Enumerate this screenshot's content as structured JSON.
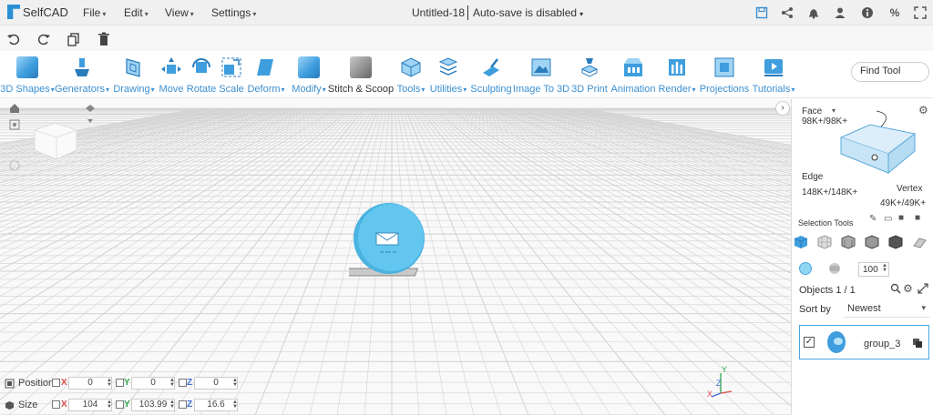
{
  "app": {
    "name": "SelfCAD"
  },
  "menu": [
    {
      "label": "File"
    },
    {
      "label": "Edit"
    },
    {
      "label": "View"
    },
    {
      "label": "Settings"
    }
  ],
  "document": {
    "title": "Untitled-18",
    "autosave": "Auto-save is disabled"
  },
  "toolbar_icons": [
    "save-icon",
    "share-icon",
    "bell-icon",
    "user-icon",
    "info-icon",
    "percent-icon",
    "fullscreen-icon"
  ],
  "quick_icons": [
    "undo-icon",
    "redo-icon",
    "copy-icon",
    "trash-icon"
  ],
  "tools": [
    {
      "label": "3D Shapes",
      "dropdown": true
    },
    {
      "label": "Generators",
      "dropdown": true
    },
    {
      "label": "Drawing",
      "dropdown": true
    },
    {
      "label": "Move",
      "dropdown": false
    },
    {
      "label": "Rotate",
      "dropdown": false
    },
    {
      "label": "Scale",
      "dropdown": false
    },
    {
      "label": "Deform",
      "dropdown": true
    },
    {
      "label": "Modify",
      "dropdown": true
    },
    {
      "label": "Stitch & Scoop",
      "dropdown": false
    },
    {
      "label": "Tools",
      "dropdown": true
    },
    {
      "label": "Utilities",
      "dropdown": true
    },
    {
      "label": "Sculpting",
      "dropdown": false
    },
    {
      "label": "Image To 3D",
      "dropdown": false
    },
    {
      "label": "3D Print",
      "dropdown": false
    },
    {
      "label": "Animation",
      "dropdown": false
    },
    {
      "label": "Render",
      "dropdown": true
    },
    {
      "label": "Projections",
      "dropdown": false
    },
    {
      "label": "Tutorials",
      "dropdown": true
    }
  ],
  "find_tool": {
    "placeholder": "Find Tool"
  },
  "transform": {
    "position": {
      "label": "Position",
      "x": "0",
      "y": "0",
      "z": "0"
    },
    "size": {
      "label": "Size",
      "x": "104",
      "y": "103.99",
      "z": "16.6"
    },
    "axis_labels": {
      "x": "X",
      "y": "Y",
      "z": "Z"
    }
  },
  "axis_gizmo": {
    "x": "X",
    "y": "Y",
    "z": "Z"
  },
  "selection": {
    "face_label": "Face",
    "face_count": "98K+/98K+",
    "edge_label": "Edge",
    "edge_count": "148K+/148K+",
    "vertex_label": "Vertex",
    "vertex_count": "49K+/49K+",
    "tools_label": "Selection Tools",
    "opacity": "100"
  },
  "objects": {
    "header": "Objects 1 / 1",
    "sort_label": "Sort by",
    "sort_value": "Newest",
    "items": [
      {
        "name": "group_3"
      }
    ]
  },
  "colors": {
    "accent": "#3c8fd0",
    "model": "#62c6ef",
    "grid": "#d2d2d2"
  }
}
